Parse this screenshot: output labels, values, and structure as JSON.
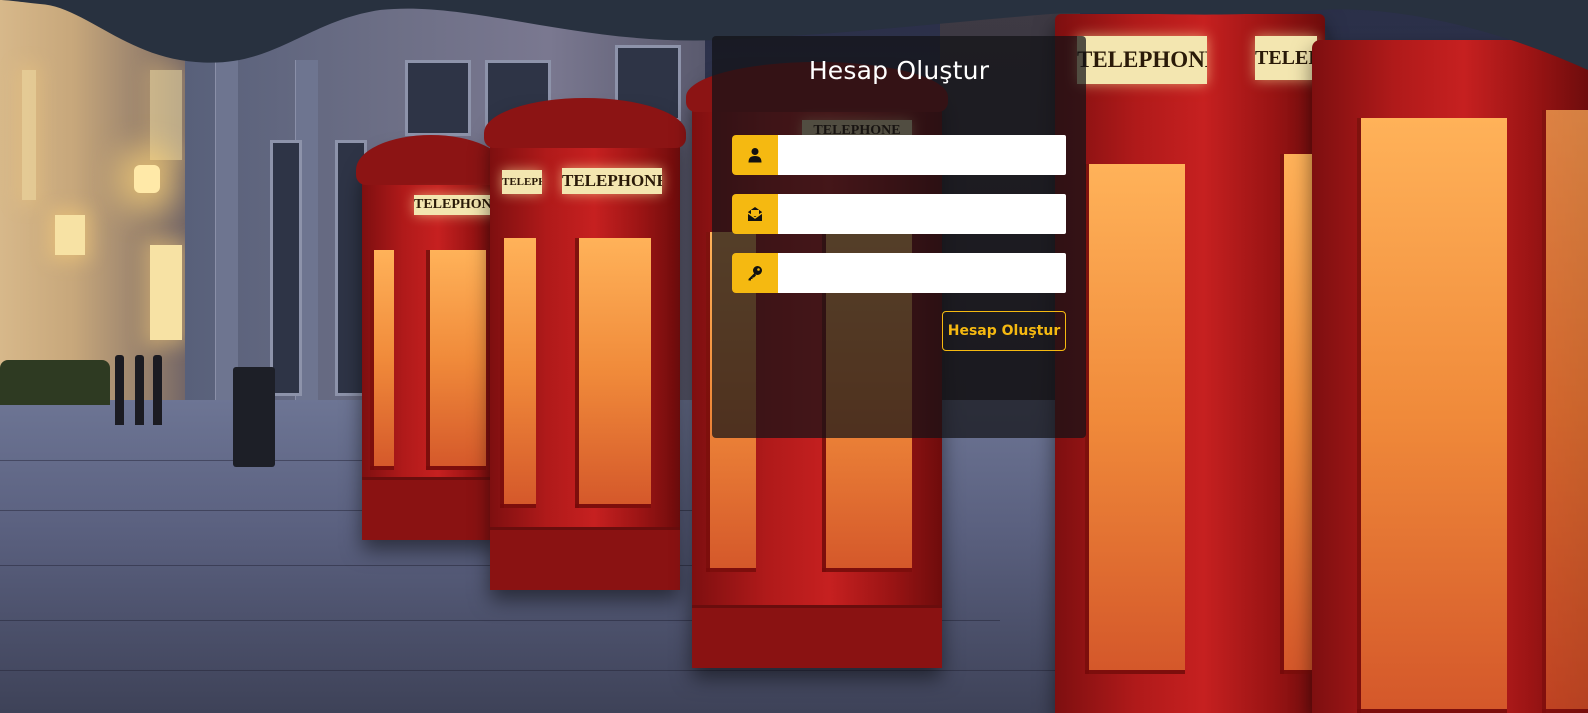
{
  "form": {
    "title": "Hesap Oluştur",
    "fields": [
      {
        "icon": "user-icon",
        "value": "",
        "placeholder": ""
      },
      {
        "icon": "envelope-icon",
        "value": "",
        "placeholder": ""
      },
      {
        "icon": "key-icon",
        "value": "",
        "placeholder": ""
      }
    ],
    "submit_label": "Hesap Oluştur"
  },
  "background": {
    "booth_sign_text": "TELEPHONE"
  },
  "colors": {
    "accent": "#f5b911",
    "panel_bg": "rgba(18,18,22,0.72)",
    "banner": "#28313f",
    "booth_red": "#b01a1a"
  }
}
